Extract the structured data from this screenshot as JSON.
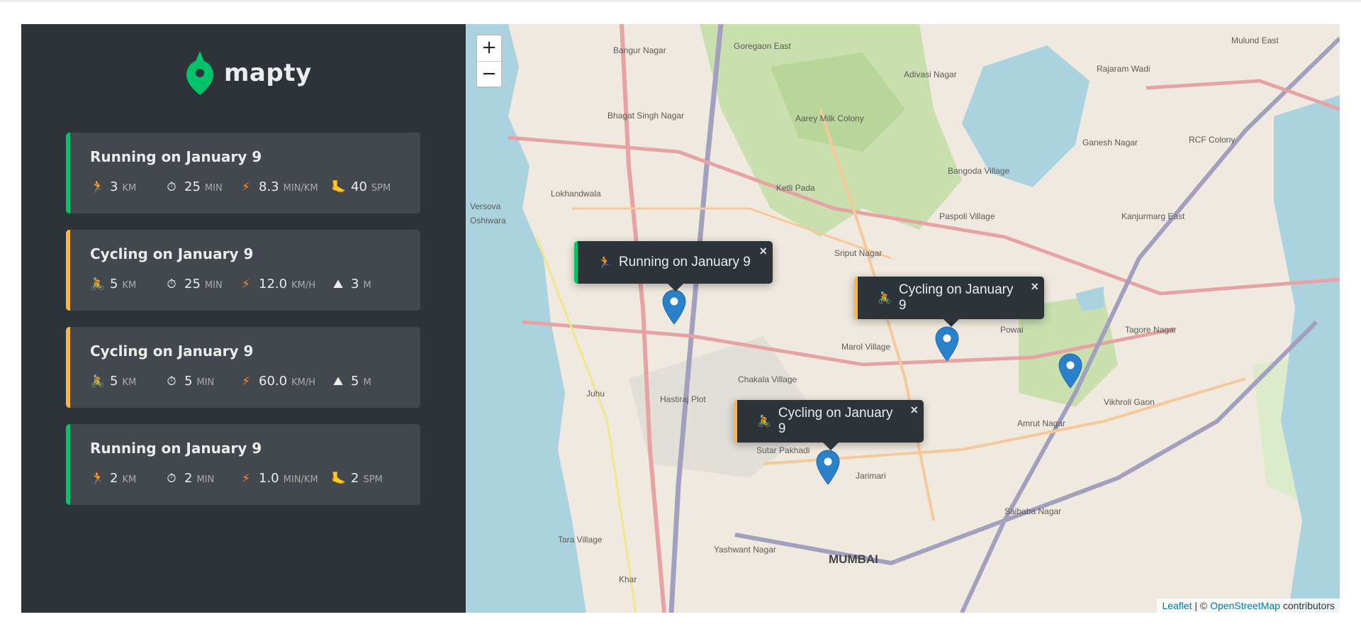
{
  "app": {
    "name": "mapty",
    "accent_running": "#00c46a",
    "accent_cycling": "#ffb545"
  },
  "workouts": [
    {
      "type": "running",
      "title": "Running on January 9",
      "icon": "runner-icon",
      "stats": [
        {
          "icon": "🏃",
          "name": "distance",
          "value": "3",
          "unit": "KM"
        },
        {
          "icon": "⏱",
          "name": "duration",
          "value": "25",
          "unit": "MIN"
        },
        {
          "icon": "⚡",
          "name": "pace",
          "value": "8.3",
          "unit": "MIN/KM"
        },
        {
          "icon": "🦶",
          "name": "cadence",
          "value": "40",
          "unit": "SPM"
        }
      ]
    },
    {
      "type": "cycling",
      "title": "Cycling on January 9",
      "icon": "cyclist-icon",
      "stats": [
        {
          "icon": "🚴",
          "name": "distance",
          "value": "5",
          "unit": "KM"
        },
        {
          "icon": "⏱",
          "name": "duration",
          "value": "25",
          "unit": "MIN"
        },
        {
          "icon": "⚡",
          "name": "speed",
          "value": "12.0",
          "unit": "KM/H"
        },
        {
          "icon": "⛰",
          "name": "elevation",
          "value": "3",
          "unit": "M"
        }
      ]
    },
    {
      "type": "cycling",
      "title": "Cycling on January 9",
      "icon": "cyclist-icon",
      "stats": [
        {
          "icon": "🚴",
          "name": "distance",
          "value": "5",
          "unit": "KM"
        },
        {
          "icon": "⏱",
          "name": "duration",
          "value": "5",
          "unit": "MIN"
        },
        {
          "icon": "⚡",
          "name": "speed",
          "value": "60.0",
          "unit": "KM/H"
        },
        {
          "icon": "⛰",
          "name": "elevation",
          "value": "5",
          "unit": "M"
        }
      ]
    },
    {
      "type": "running",
      "title": "Running on January 9",
      "icon": "runner-icon",
      "stats": [
        {
          "icon": "🏃",
          "name": "distance",
          "value": "2",
          "unit": "KM"
        },
        {
          "icon": "⏱",
          "name": "duration",
          "value": "2",
          "unit": "MIN"
        },
        {
          "icon": "⚡",
          "name": "pace",
          "value": "1.0",
          "unit": "MIN/KM"
        },
        {
          "icon": "🦶",
          "name": "cadence",
          "value": "2",
          "unit": "SPM"
        }
      ]
    }
  ],
  "map": {
    "zoom_in": "+",
    "zoom_out": "−",
    "popups": [
      {
        "type": "running",
        "icon": "🏃",
        "text": "Running on January 9",
        "close": "×"
      },
      {
        "type": "cycling",
        "icon": "🚴",
        "text": "Cycling on January 9",
        "close": "×"
      },
      {
        "type": "cycling",
        "icon": "🚴",
        "text": "Cycling on January 9",
        "close": "×"
      }
    ],
    "place_labels": [
      "Goregaon East",
      "Bangur Nagar",
      "Bhagat Singh Nagar",
      "Lokhandwala",
      "Aarey Milk Colony",
      "Ketli Pada",
      "Adivasi Nagar",
      "Bangoda Village",
      "Paspoli Village",
      "Sriput Nagar",
      "Marol Village",
      "Chakala Village",
      "Hastiraj Plot",
      "Juhu",
      "Sutar Pakhadi",
      "Jarimari",
      "Amrut Nagar",
      "Powai",
      "Tagore Nagar",
      "Vikhroli Gaon",
      "Ganesh Nagar",
      "Rajaram Wadi",
      "Mulund East",
      "Kanjurmarg East",
      "RCF Colony",
      "Saibaba Nagar",
      "Yashwant Nagar",
      "Tara Village",
      "Khar",
      "Versova",
      "Oshiwara",
      "MUMBAI"
    ],
    "attribution": {
      "leaflet": "Leaflet",
      "separator": " | © ",
      "osm": "OpenStreetMap",
      "suffix": " contributors"
    }
  }
}
